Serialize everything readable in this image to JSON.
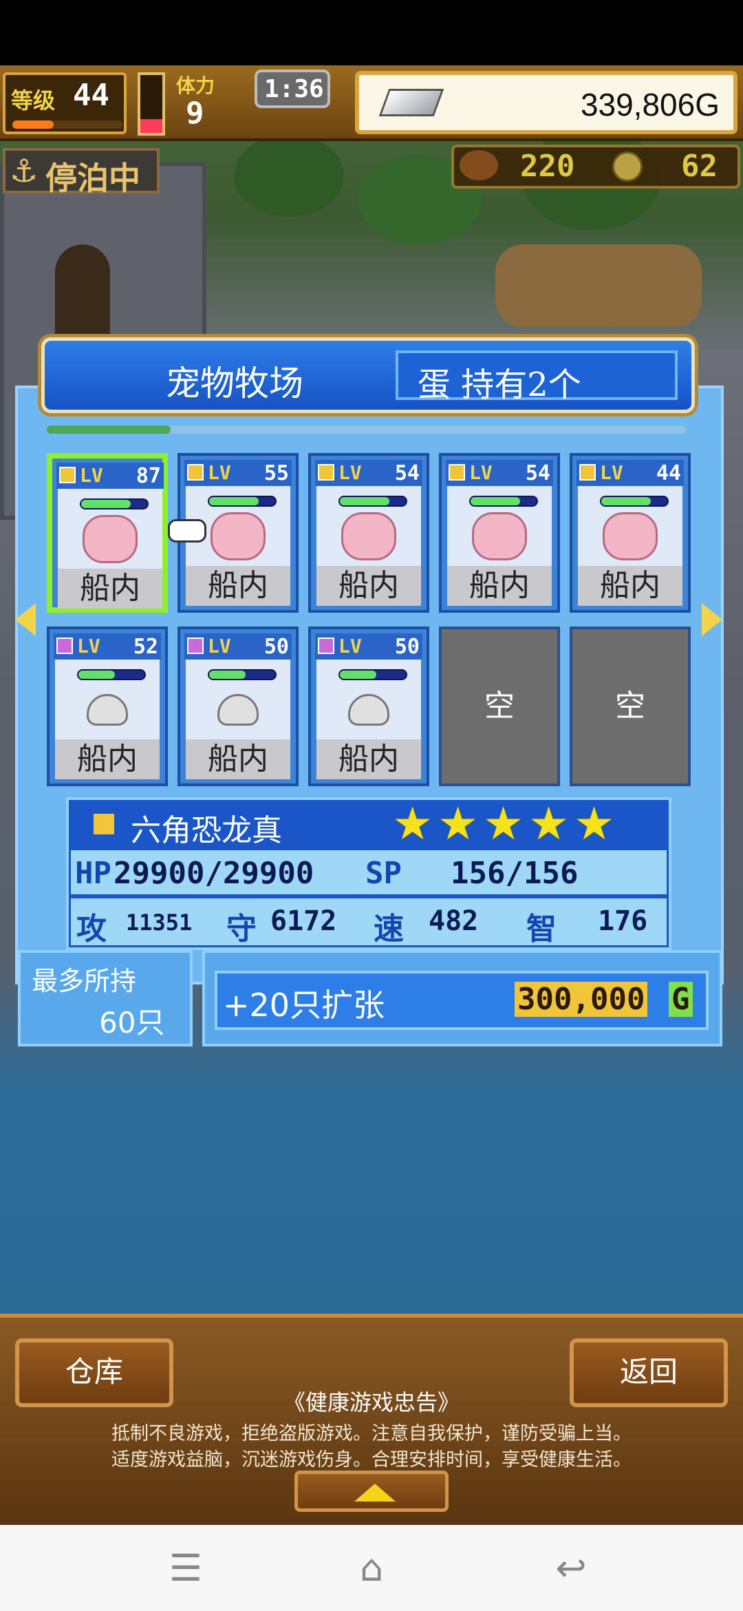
{
  "hud": {
    "level_label": "等级",
    "level": "44",
    "stamina_label": "体力",
    "stamina": "9",
    "timer": "1:36",
    "gold": "339,806G",
    "status": "停泊中",
    "food": "220",
    "coins": "62"
  },
  "dialog": {
    "title": "宠物牧场",
    "eggs": "蛋 持有2个"
  },
  "pets": [
    {
      "lv_label": "LV",
      "lv": "87",
      "location": "船内",
      "kind": "axolotl",
      "selected": true,
      "hp_fill": 0.75
    },
    {
      "lv_label": "LV",
      "lv": "55",
      "location": "船内",
      "kind": "axolotl",
      "selected": false,
      "hp_fill": 0.75
    },
    {
      "lv_label": "LV",
      "lv": "54",
      "location": "船内",
      "kind": "axolotl",
      "selected": false,
      "hp_fill": 0.75
    },
    {
      "lv_label": "LV",
      "lv": "54",
      "location": "船内",
      "kind": "axolotl",
      "selected": false,
      "hp_fill": 0.75
    },
    {
      "lv_label": "LV",
      "lv": "44",
      "location": "船内",
      "kind": "axolotl",
      "selected": false,
      "hp_fill": 0.75
    },
    {
      "lv_label": "LV",
      "lv": "52",
      "location": "船内",
      "kind": "cat",
      "selected": false,
      "hp_fill": 0.55
    },
    {
      "lv_label": "LV",
      "lv": "50",
      "location": "船内",
      "kind": "cat",
      "selected": false,
      "hp_fill": 0.55
    },
    {
      "lv_label": "LV",
      "lv": "50",
      "location": "船内",
      "kind": "cat",
      "selected": false,
      "hp_fill": 0.55
    }
  ],
  "empty_slot_label": "空",
  "selected_pet": {
    "name": "六角恐龙真",
    "stars": 5,
    "hp_label": "HP",
    "hp": "29900/29900",
    "sp_label": "SP",
    "sp": "156/156",
    "atk_label": "攻",
    "atk": "11351",
    "def_label": "守",
    "def": "6172",
    "spd_label": "速",
    "spd": "482",
    "int_label": "智",
    "int": "176"
  },
  "capacity": {
    "label": "最多所持",
    "value": "60只"
  },
  "expand": {
    "label": "+20只扩张",
    "cost": "300,000",
    "cost_unit": "G"
  },
  "bottom": {
    "warehouse_button": "仓库",
    "back_button": "返回",
    "notice_title": "《健康游戏忠告》",
    "notice_line1": "抵制不良游戏，拒绝盗版游戏。注意自我保护，谨防受骗上当。",
    "notice_line2": "适度游戏益脑，沉迷游戏伤身。合理安排时间，享受健康生活。"
  },
  "colors": {
    "dialog_blue": "#1752c4",
    "selected_border": "#8ef02a",
    "star": "#f6e21a",
    "gold_cost": "#f0c53a"
  }
}
